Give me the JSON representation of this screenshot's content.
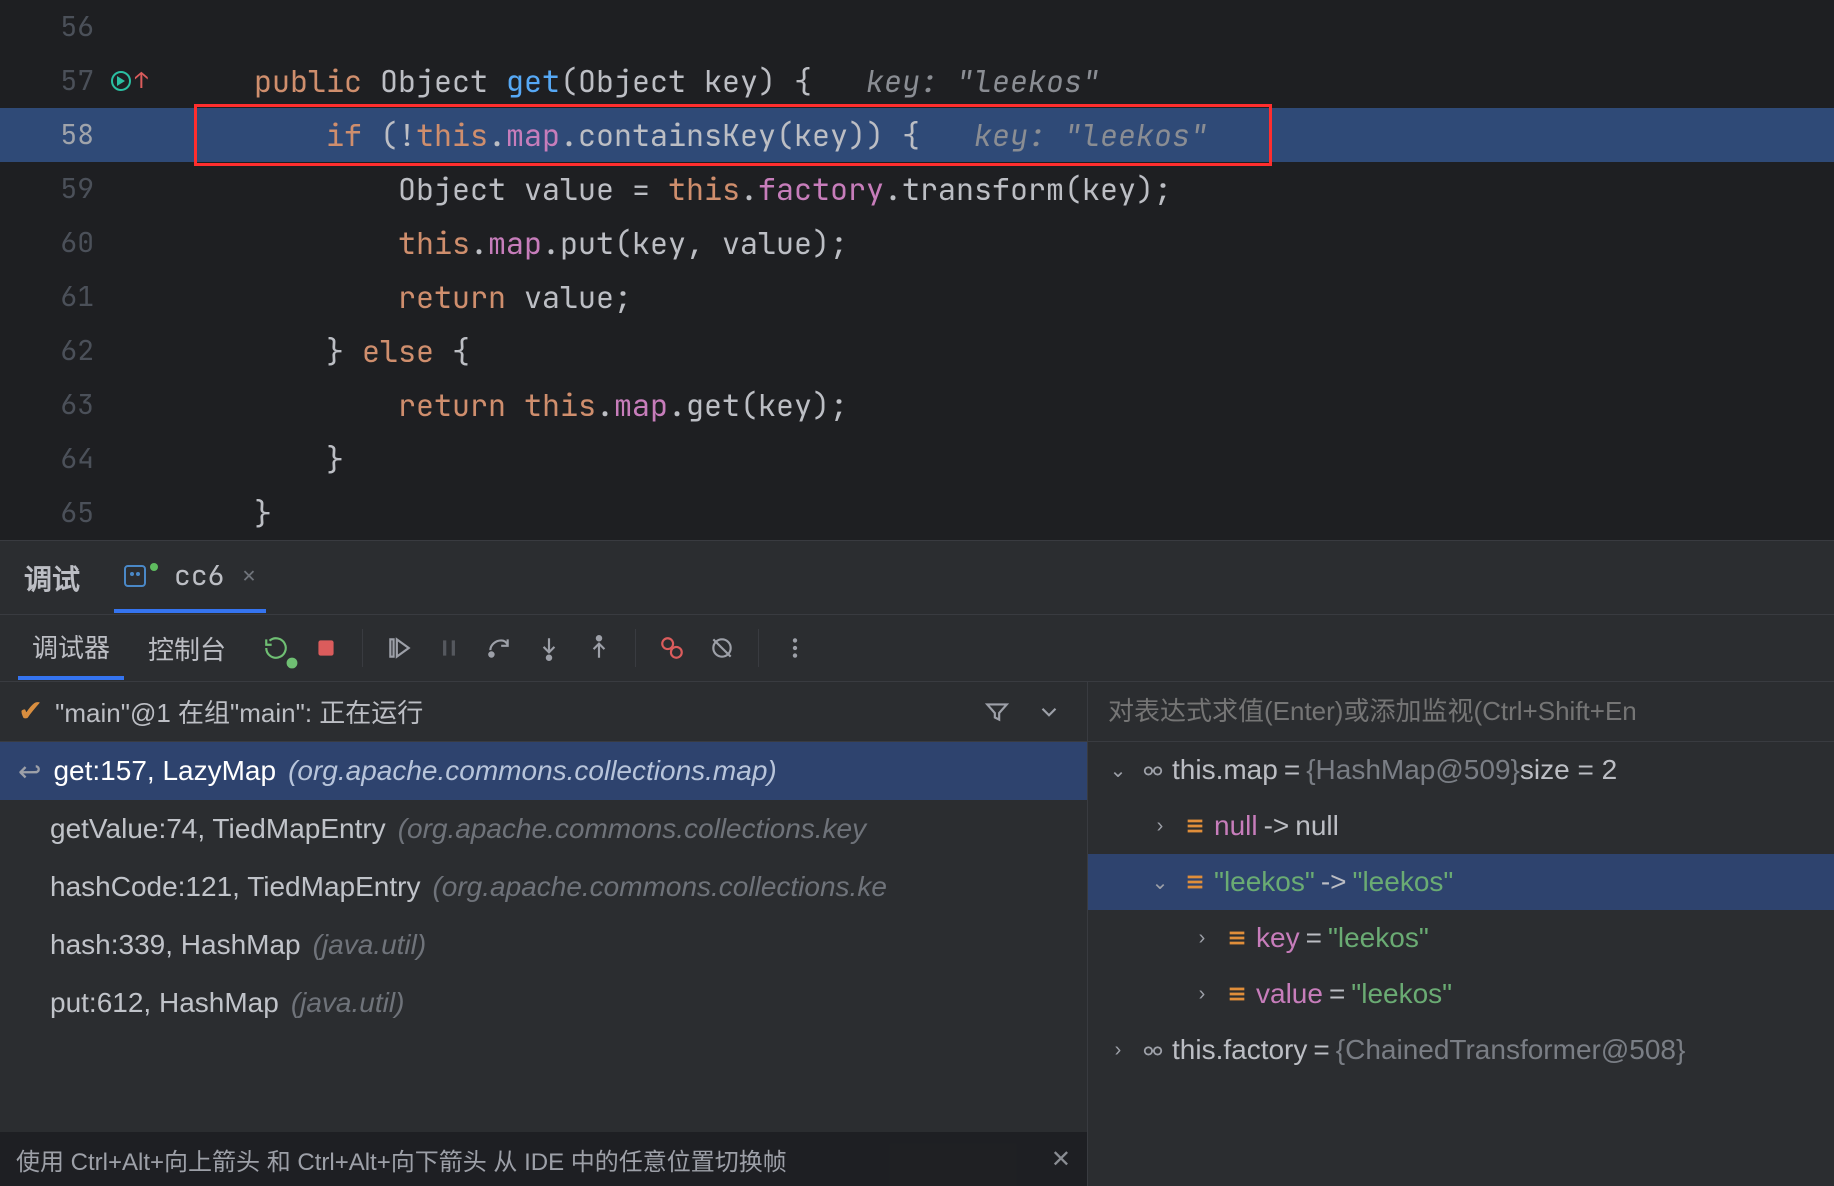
{
  "editor": {
    "lines": [
      {
        "no": 56,
        "indent": 0,
        "tokens": []
      },
      {
        "no": 57,
        "indent": 1,
        "run_icon": true,
        "tokens": [
          {
            "t": "public ",
            "c": "kw"
          },
          {
            "t": "Object ",
            "c": "typ"
          },
          {
            "t": "get",
            "c": "mthd"
          },
          {
            "t": "(",
            "c": "punct"
          },
          {
            "t": "Object ",
            "c": "typ"
          },
          {
            "t": "key",
            "c": "ident"
          },
          {
            "t": ") {",
            "c": "punct"
          },
          {
            "t": "   key: \"leekos\"",
            "c": "hint"
          }
        ]
      },
      {
        "no": 58,
        "indent": 2,
        "hl": true,
        "box": true,
        "tokens": [
          {
            "t": "if ",
            "c": "kw"
          },
          {
            "t": "(!",
            "c": "punct"
          },
          {
            "t": "this",
            "c": "kw"
          },
          {
            "t": ".",
            "c": "punct"
          },
          {
            "t": "map",
            "c": "fld"
          },
          {
            "t": ".",
            "c": "punct"
          },
          {
            "t": "containsKey",
            "c": "ident"
          },
          {
            "t": "(",
            "c": "punct"
          },
          {
            "t": "key",
            "c": "ident"
          },
          {
            "t": ")) {",
            "c": "punct"
          },
          {
            "t": "   key: \"leekos\"",
            "c": "hint"
          }
        ]
      },
      {
        "no": 59,
        "indent": 3,
        "tokens": [
          {
            "t": "Object ",
            "c": "typ"
          },
          {
            "t": "value ",
            "c": "ident"
          },
          {
            "t": "= ",
            "c": "punct"
          },
          {
            "t": "this",
            "c": "kw"
          },
          {
            "t": ".",
            "c": "punct"
          },
          {
            "t": "factory",
            "c": "fld"
          },
          {
            "t": ".",
            "c": "punct"
          },
          {
            "t": "transform",
            "c": "ident"
          },
          {
            "t": "(",
            "c": "punct"
          },
          {
            "t": "key",
            "c": "ident"
          },
          {
            "t": ");",
            "c": "punct"
          }
        ]
      },
      {
        "no": 60,
        "indent": 3,
        "tokens": [
          {
            "t": "this",
            "c": "kw"
          },
          {
            "t": ".",
            "c": "punct"
          },
          {
            "t": "map",
            "c": "fld"
          },
          {
            "t": ".",
            "c": "punct"
          },
          {
            "t": "put",
            "c": "ident"
          },
          {
            "t": "(",
            "c": "punct"
          },
          {
            "t": "key",
            "c": "ident"
          },
          {
            "t": ", ",
            "c": "punct"
          },
          {
            "t": "value",
            "c": "ident"
          },
          {
            "t": ");",
            "c": "punct"
          }
        ]
      },
      {
        "no": 61,
        "indent": 3,
        "tokens": [
          {
            "t": "return ",
            "c": "kw"
          },
          {
            "t": "value",
            "c": "ident"
          },
          {
            "t": ";",
            "c": "punct"
          }
        ]
      },
      {
        "no": 62,
        "indent": 2,
        "tokens": [
          {
            "t": "} ",
            "c": "punct"
          },
          {
            "t": "else ",
            "c": "kw"
          },
          {
            "t": "{",
            "c": "punct"
          }
        ]
      },
      {
        "no": 63,
        "indent": 3,
        "tokens": [
          {
            "t": "return ",
            "c": "kw"
          },
          {
            "t": "this",
            "c": "kw"
          },
          {
            "t": ".",
            "c": "punct"
          },
          {
            "t": "map",
            "c": "fld"
          },
          {
            "t": ".",
            "c": "punct"
          },
          {
            "t": "get",
            "c": "ident"
          },
          {
            "t": "(",
            "c": "punct"
          },
          {
            "t": "key",
            "c": "ident"
          },
          {
            "t": ");",
            "c": "punct"
          }
        ]
      },
      {
        "no": 64,
        "indent": 2,
        "tokens": [
          {
            "t": "}",
            "c": "punct"
          }
        ]
      },
      {
        "no": 65,
        "indent": 1,
        "tokens": [
          {
            "t": "}",
            "c": "punct"
          }
        ]
      }
    ]
  },
  "debug_strip": {
    "title": "调试",
    "run_config": "cc6"
  },
  "dbg_tabs": {
    "debugger": "调试器",
    "console": "控制台"
  },
  "toolbar_btns": [
    "rerun",
    "stop",
    "sep",
    "resume",
    "pause",
    "step-over",
    "step-into",
    "step-out",
    "sep",
    "view-bp",
    "mute-bp",
    "sep",
    "more"
  ],
  "frames": {
    "thread_label": "\"main\"@1 在组\"main\": 正在运行",
    "entries": [
      {
        "sig": "get:157, LazyMap ",
        "pkg": "(org.apache.commons.collections.map)",
        "sel": true,
        "back": true
      },
      {
        "sig": "getValue:74, TiedMapEntry ",
        "pkg": "(org.apache.commons.collections.key"
      },
      {
        "sig": "hashCode:121, TiedMapEntry ",
        "pkg": "(org.apache.commons.collections.ke"
      },
      {
        "sig": "hash:339, HashMap ",
        "pkg": "(java.util)"
      },
      {
        "sig": "put:612, HashMap ",
        "pkg": "(java.util)"
      }
    ],
    "hint": "使用 Ctrl+Alt+向上箭头 和 Ctrl+Alt+向下箭头 从 IDE 中的任意位置切换帧"
  },
  "vars": {
    "placeholder": "对表达式求值(Enter)或添加监视(Ctrl+Shift+En",
    "tree": [
      {
        "depth": 0,
        "exp": "open",
        "icon": "glasses",
        "name": "this.map",
        "nclass": "plain",
        "eq": " = ",
        "type": "{HashMap@509}",
        "tail": "  size = 2"
      },
      {
        "depth": 1,
        "exp": "closed",
        "icon": "field",
        "name": "null",
        "nclass": "fld",
        "eq": " -> ",
        "val": "null",
        "vclass": "plain"
      },
      {
        "depth": 1,
        "exp": "open",
        "icon": "field",
        "sel": true,
        "name": "\"leekos\"",
        "nclass": "str",
        "eq": " -> ",
        "val": "\"leekos\"",
        "vclass": "str"
      },
      {
        "depth": 2,
        "exp": "closed",
        "icon": "field",
        "name": "key",
        "nclass": "fld",
        "eq": " = ",
        "val": "\"leekos\"",
        "vclass": "str"
      },
      {
        "depth": 2,
        "exp": "closed",
        "icon": "field",
        "name": "value",
        "nclass": "fld",
        "eq": " = ",
        "val": "\"leekos\"",
        "vclass": "str"
      },
      {
        "depth": 0,
        "exp": "closed",
        "icon": "glasses",
        "name": "this.factory",
        "nclass": "plain",
        "eq": " = ",
        "type": "{ChainedTransformer@508}"
      }
    ]
  }
}
